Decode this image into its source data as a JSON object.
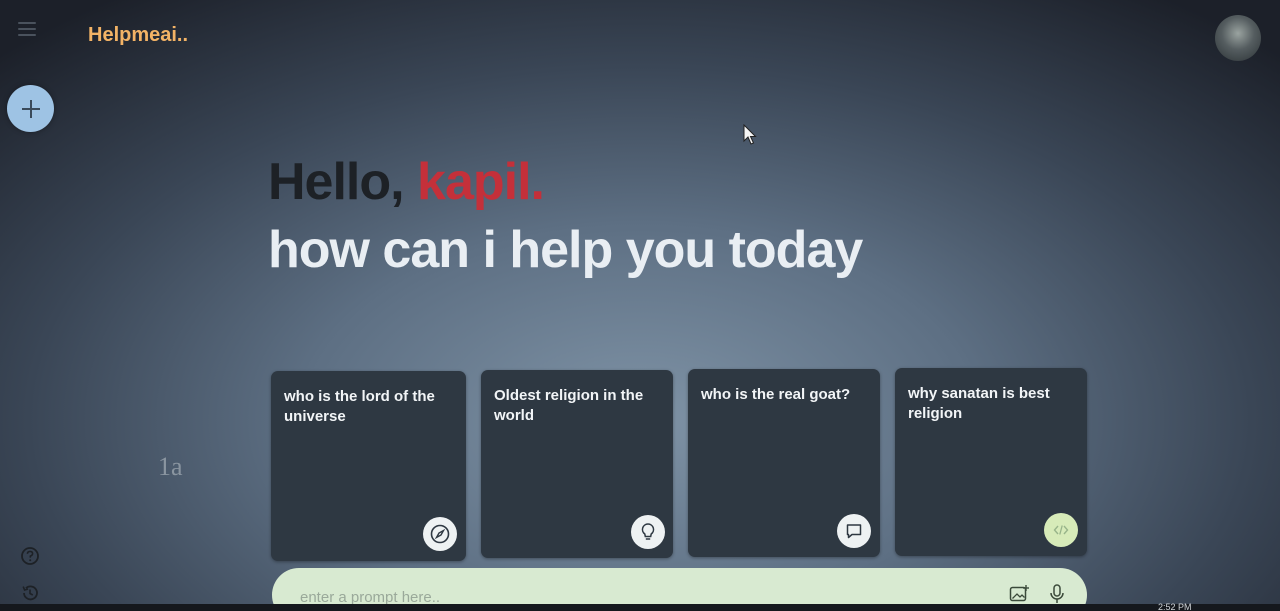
{
  "app": {
    "title": "Helpmeai.."
  },
  "greeting": {
    "hello": "Hello, ",
    "name": "kapil.",
    "subtitle": "how can i help you today"
  },
  "cards": [
    {
      "text": "who is the lord of the universe",
      "icon": "compass-icon"
    },
    {
      "text": "Oldest religion in the world",
      "icon": "bulb-icon"
    },
    {
      "text": "who is the real goat?",
      "icon": "message-icon"
    },
    {
      "text": "why sanatan is best religion",
      "icon": "code-icon"
    }
  ],
  "stray_text": "1a",
  "prompt": {
    "placeholder": "enter a prompt here.."
  },
  "taskbar": {
    "time": "2:52 PM"
  },
  "colors": {
    "title": "#f3b366",
    "name_accent": "#c4303a",
    "new_chat_button": "#9ec3e4",
    "card_bg": "#2e3842",
    "prompt_bg": "#d8ead1"
  }
}
